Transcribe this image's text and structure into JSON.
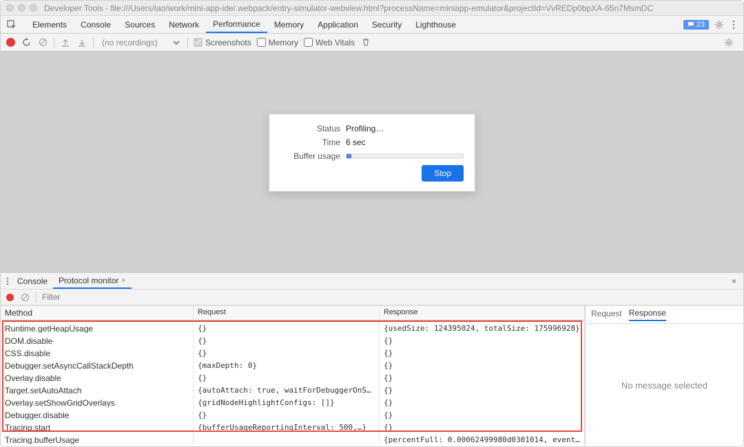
{
  "window": {
    "title": "Developer Tools - file:///Users/tao/work/mini-app-ide/.webpack/entry-simulator-webview.html?processName=miniapp-emulator&projectId=VvREDp0bpXA-65n7MsmDC"
  },
  "tabs": {
    "items": [
      "Elements",
      "Console",
      "Sources",
      "Network",
      "Performance",
      "Memory",
      "Application",
      "Security",
      "Lighthouse"
    ],
    "active_index": 4,
    "message_count": "23"
  },
  "perf_toolbar": {
    "recordings_placeholder": "(no recordings)",
    "checkboxes": {
      "screenshots": "Screenshots",
      "memory": "Memory",
      "webvitals": "Web Vitals"
    }
  },
  "profiling_dialog": {
    "status_label": "Status",
    "status_value": "Profiling…",
    "time_label": "Time",
    "time_value": "6 sec",
    "buffer_label": "Buffer usage",
    "buffer_percent": 4,
    "stop_label": "Stop"
  },
  "drawer": {
    "tabs": {
      "console": "Console",
      "protocol": "Protocol monitor"
    },
    "active": "protocol",
    "filter_placeholder": "Filter"
  },
  "protocol": {
    "headers": {
      "method": "Method",
      "request": "Request",
      "response": "Response"
    },
    "rows": [
      {
        "method": "Runtime.getHeapUsage",
        "request": "{}",
        "response": "{usedSize: 124395024, totalSize: 175996928}"
      },
      {
        "method": "DOM.disable",
        "request": "{}",
        "response": "{}"
      },
      {
        "method": "CSS.disable",
        "request": "{}",
        "response": "{}"
      },
      {
        "method": "Debugger.setAsyncCallStackDepth",
        "request": "{maxDepth: 0}",
        "response": "{}"
      },
      {
        "method": "Overlay.disable",
        "request": "{}",
        "response": "{}"
      },
      {
        "method": "Target.setAutoAttach",
        "request": "{autoAttach: true, waitForDebuggerOnStart:…",
        "response": "{}"
      },
      {
        "method": "Overlay.setShowGridOverlays",
        "request": "{gridNodeHighlightConfigs: []}",
        "response": "{}"
      },
      {
        "method": "Debugger.disable",
        "request": "{}",
        "response": "{}"
      },
      {
        "method": "Tracing.start",
        "request": "{bufferUsageReportingInterval: 500,…}",
        "response": "{}"
      },
      {
        "method": "Tracing.bufferUsage",
        "request": "",
        "response": "{percentFull: 0.00062499980d0301014, event…"
      }
    ],
    "highlight_start_row": 0,
    "highlight_end_row": 8,
    "side_tabs": {
      "request": "Request",
      "response": "Response"
    },
    "side_active": "response",
    "no_message": "No message selected"
  }
}
